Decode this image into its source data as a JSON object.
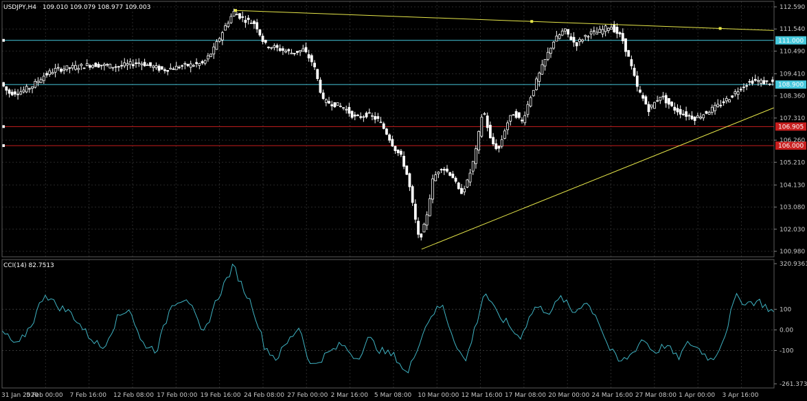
{
  "header": {
    "symbol": "USDJPY,H4",
    "ohlc": "109.010 109.079 108.977 109.003"
  },
  "indicator": {
    "title": "CCI(14) 82.7513",
    "axis_labels": [
      "320.9361",
      "100",
      "0.00",
      "-100",
      "-261.3731"
    ],
    "axis_values": [
      320.9361,
      100,
      0,
      -100,
      -261.3731
    ]
  },
  "colors": {
    "background": "#000000",
    "up_candle": "#ffffff",
    "down_candle": "#ffffff",
    "cci_line": "#3fb4c4",
    "grid": "#2a2a2a",
    "trendline": "#e8e84a",
    "level_cyan": "#46c8dc",
    "level_red": "#c81e1e"
  },
  "chart_data": {
    "type": "candlestick",
    "price_axis_labels": [
      "112.590",
      "111.540",
      "110.490",
      "109.410",
      "108.360",
      "107.310",
      "106.260",
      "105.210",
      "104.130",
      "103.080",
      "102.030",
      "100.980"
    ],
    "price_range": [
      100.98,
      112.59
    ],
    "time_labels": [
      "31 Jan 2020",
      "5 Feb 00:00",
      "7 Feb 16:00",
      "12 Feb 08:00",
      "17 Feb 00:00",
      "19 Feb 16:00",
      "24 Feb 08:00",
      "27 Feb 00:00",
      "2 Mar 16:00",
      "5 Mar 08:00",
      "10 Mar 00:00",
      "12 Mar 16:00",
      "17 Mar 08:00",
      "20 Mar 00:00",
      "24 Mar 16:00",
      "27 Mar 08:00",
      "1 Apr 00:00",
      "3 Apr 16:00"
    ],
    "horizontal_levels": [
      {
        "value": 111.0,
        "label": "111.000",
        "color": "#46c8dc"
      },
      {
        "value": 108.9,
        "label": "108.900",
        "color": "#46c8dc"
      },
      {
        "value": 106.905,
        "label": "106.905",
        "color": "#c81e1e"
      },
      {
        "value": 106.0,
        "label": "106.000",
        "color": "#c81e1e"
      }
    ],
    "trendlines": [
      {
        "from": {
          "bar": 0.3025,
          "price": 112.42
        },
        "to": {
          "bar": 1.0,
          "price": 111.47
        },
        "handles": true
      },
      {
        "from": {
          "bar": 0.5434,
          "price": 101.08
        },
        "to": {
          "bar": 1.0,
          "price": 107.8
        },
        "handles": false
      }
    ],
    "price_path": [
      [
        0,
        109.0
      ],
      [
        0.01,
        108.5
      ],
      [
        0.025,
        108.55
      ],
      [
        0.04,
        108.8
      ],
      [
        0.055,
        109.3
      ],
      [
        0.07,
        109.6
      ],
      [
        0.09,
        109.7
      ],
      [
        0.12,
        109.85
      ],
      [
        0.15,
        109.75
      ],
      [
        0.18,
        109.95
      ],
      [
        0.21,
        109.6
      ],
      [
        0.24,
        109.8
      ],
      [
        0.262,
        109.9
      ],
      [
        0.275,
        110.5
      ],
      [
        0.29,
        111.6
      ],
      [
        0.302,
        112.35
      ],
      [
        0.315,
        112.0
      ],
      [
        0.33,
        111.8
      ],
      [
        0.342,
        110.8
      ],
      [
        0.36,
        110.6
      ],
      [
        0.378,
        110.4
      ],
      [
        0.392,
        110.55
      ],
      [
        0.405,
        109.9
      ],
      [
        0.418,
        108.1
      ],
      [
        0.43,
        108.0
      ],
      [
        0.445,
        107.8
      ],
      [
        0.46,
        107.3
      ],
      [
        0.475,
        107.5
      ],
      [
        0.49,
        107.2
      ],
      [
        0.5,
        106.6
      ],
      [
        0.51,
        105.9
      ],
      [
        0.52,
        105.4
      ],
      [
        0.528,
        104.4
      ],
      [
        0.535,
        102.9
      ],
      [
        0.542,
        101.5
      ],
      [
        0.55,
        102.3
      ],
      [
        0.56,
        104.4
      ],
      [
        0.57,
        105.0
      ],
      [
        0.585,
        104.6
      ],
      [
        0.595,
        103.7
      ],
      [
        0.605,
        104.3
      ],
      [
        0.615,
        105.6
      ],
      [
        0.625,
        107.8
      ],
      [
        0.635,
        106.2
      ],
      [
        0.645,
        105.8
      ],
      [
        0.655,
        107.0
      ],
      [
        0.665,
        107.6
      ],
      [
        0.675,
        107.1
      ],
      [
        0.688,
        108.5
      ],
      [
        0.7,
        109.6
      ],
      [
        0.715,
        110.9
      ],
      [
        0.73,
        111.5
      ],
      [
        0.745,
        110.8
      ],
      [
        0.76,
        111.3
      ],
      [
        0.775,
        111.4
      ],
      [
        0.79,
        111.7
      ],
      [
        0.805,
        111.1
      ],
      [
        0.815,
        110.0
      ],
      [
        0.825,
        108.7
      ],
      [
        0.84,
        107.7
      ],
      [
        0.855,
        108.4
      ],
      [
        0.87,
        107.8
      ],
      [
        0.885,
        107.5
      ],
      [
        0.9,
        107.3
      ],
      [
        0.915,
        107.6
      ],
      [
        0.93,
        107.9
      ],
      [
        0.945,
        108.3
      ],
      [
        0.96,
        108.8
      ],
      [
        0.975,
        109.1
      ],
      [
        0.99,
        109.0
      ],
      [
        1.0,
        109.0
      ]
    ],
    "cci_path": [
      [
        0,
        -10
      ],
      [
        0.02,
        -80
      ],
      [
        0.04,
        40
      ],
      [
        0.055,
        180
      ],
      [
        0.07,
        120
      ],
      [
        0.09,
        80
      ],
      [
        0.11,
        -20
      ],
      [
        0.13,
        -90
      ],
      [
        0.15,
        60
      ],
      [
        0.165,
        110
      ],
      [
        0.18,
        -60
      ],
      [
        0.2,
        -100
      ],
      [
        0.22,
        130
      ],
      [
        0.24,
        160
      ],
      [
        0.26,
        -30
      ],
      [
        0.275,
        120
      ],
      [
        0.29,
        240
      ],
      [
        0.3,
        310
      ],
      [
        0.31,
        220
      ],
      [
        0.325,
        110
      ],
      [
        0.34,
        -80
      ],
      [
        0.355,
        -140
      ],
      [
        0.37,
        -60
      ],
      [
        0.385,
        20
      ],
      [
        0.4,
        -180
      ],
      [
        0.42,
        -120
      ],
      [
        0.44,
        -70
      ],
      [
        0.46,
        -140
      ],
      [
        0.475,
        -40
      ],
      [
        0.49,
        -100
      ],
      [
        0.51,
        -130
      ],
      [
        0.525,
        -220
      ],
      [
        0.54,
        -60
      ],
      [
        0.555,
        70
      ],
      [
        0.57,
        120
      ],
      [
        0.585,
        -40
      ],
      [
        0.6,
        -160
      ],
      [
        0.615,
        40
      ],
      [
        0.625,
        190
      ],
      [
        0.64,
        80
      ],
      [
        0.655,
        30
      ],
      [
        0.67,
        -40
      ],
      [
        0.69,
        110
      ],
      [
        0.71,
        90
      ],
      [
        0.725,
        160
      ],
      [
        0.74,
        80
      ],
      [
        0.755,
        140
      ],
      [
        0.77,
        70
      ],
      [
        0.785,
        -80
      ],
      [
        0.8,
        -160
      ],
      [
        0.815,
        -120
      ],
      [
        0.83,
        -40
      ],
      [
        0.845,
        -110
      ],
      [
        0.86,
        -70
      ],
      [
        0.875,
        -140
      ],
      [
        0.89,
        -60
      ],
      [
        0.905,
        -100
      ],
      [
        0.92,
        -150
      ],
      [
        0.935,
        -40
      ],
      [
        0.95,
        160
      ],
      [
        0.965,
        130
      ],
      [
        0.98,
        140
      ],
      [
        1.0,
        83
      ]
    ]
  }
}
